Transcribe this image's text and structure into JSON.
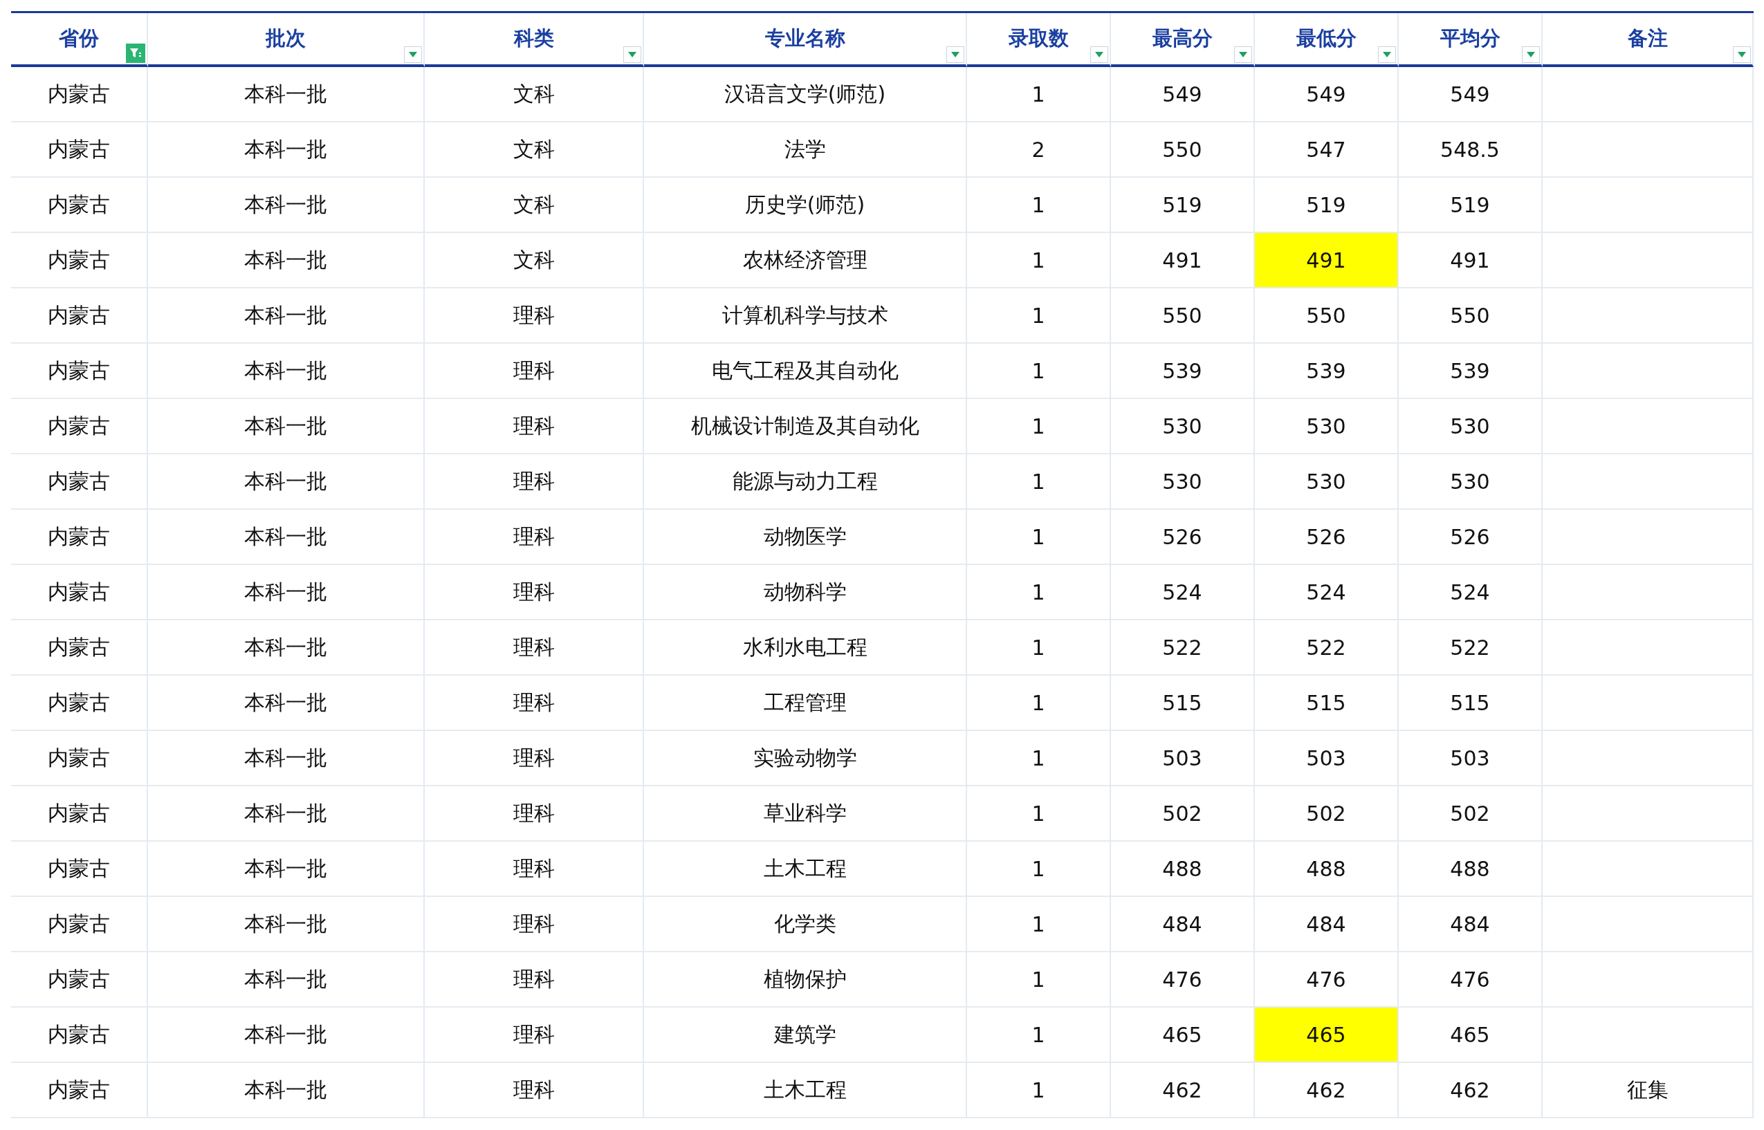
{
  "table": {
    "columns": [
      {
        "label": "省份",
        "filtered": true
      },
      {
        "label": "批次",
        "filtered": false
      },
      {
        "label": "科类",
        "filtered": false
      },
      {
        "label": "专业名称",
        "filtered": false
      },
      {
        "label": "录取数",
        "filtered": false
      },
      {
        "label": "最高分",
        "filtered": false
      },
      {
        "label": "最低分",
        "filtered": false
      },
      {
        "label": "平均分",
        "filtered": false
      },
      {
        "label": "备注",
        "filtered": false
      }
    ],
    "rows": [
      {
        "cells": [
          "内蒙古",
          "本科一批",
          "文科",
          "汉语言文学(师范)",
          "1",
          "549",
          "549",
          "549"
        ],
        "min_highlighted": false
      },
      {
        "cells": [
          "内蒙古",
          "本科一批",
          "文科",
          "法学",
          "2",
          "550",
          "547",
          "548.5"
        ],
        "min_highlighted": false
      },
      {
        "cells": [
          "内蒙古",
          "本科一批",
          "文科",
          "历史学(师范)",
          "1",
          "519",
          "519",
          "519"
        ],
        "min_highlighted": false
      },
      {
        "cells": [
          "内蒙古",
          "本科一批",
          "文科",
          "农林经济管理",
          "1",
          "491",
          "491",
          "491"
        ],
        "min_highlighted": true
      },
      {
        "cells": [
          "内蒙古",
          "本科一批",
          "理科",
          "计算机科学与技术",
          "1",
          "550",
          "550",
          "550"
        ],
        "min_highlighted": false
      },
      {
        "cells": [
          "内蒙古",
          "本科一批",
          "理科",
          "电气工程及其自动化",
          "1",
          "539",
          "539",
          "539"
        ],
        "min_highlighted": false
      },
      {
        "cells": [
          "内蒙古",
          "本科一批",
          "理科",
          "机械设计制造及其自动化",
          "1",
          "530",
          "530",
          "530"
        ],
        "min_highlighted": false
      },
      {
        "cells": [
          "内蒙古",
          "本科一批",
          "理科",
          "能源与动力工程",
          "1",
          "530",
          "530",
          "530"
        ],
        "min_highlighted": false
      },
      {
        "cells": [
          "内蒙古",
          "本科一批",
          "理科",
          "动物医学",
          "1",
          "526",
          "526",
          "526"
        ],
        "min_highlighted": false
      },
      {
        "cells": [
          "内蒙古",
          "本科一批",
          "理科",
          "动物科学",
          "1",
          "524",
          "524",
          "524"
        ],
        "min_highlighted": false
      },
      {
        "cells": [
          "内蒙古",
          "本科一批",
          "理科",
          "水利水电工程",
          "1",
          "522",
          "522",
          "522"
        ],
        "min_highlighted": false
      },
      {
        "cells": [
          "内蒙古",
          "本科一批",
          "理科",
          "工程管理",
          "1",
          "515",
          "515",
          "515"
        ],
        "min_highlighted": false
      },
      {
        "cells": [
          "内蒙古",
          "本科一批",
          "理科",
          "实验动物学",
          "1",
          "503",
          "503",
          "503"
        ],
        "min_highlighted": false
      },
      {
        "cells": [
          "内蒙古",
          "本科一批",
          "理科",
          "草业科学",
          "1",
          "502",
          "502",
          "502"
        ],
        "min_highlighted": false
      },
      {
        "cells": [
          "内蒙古",
          "本科一批",
          "理科",
          "土木工程",
          "1",
          "488",
          "488",
          "488"
        ],
        "min_highlighted": false
      },
      {
        "cells": [
          "内蒙古",
          "本科一批",
          "理科",
          "化学类",
          "1",
          "484",
          "484",
          "484"
        ],
        "min_highlighted": false
      },
      {
        "cells": [
          "内蒙古",
          "本科一批",
          "理科",
          "植物保护",
          "1",
          "476",
          "476",
          "476"
        ],
        "min_highlighted": false
      },
      {
        "cells": [
          "内蒙古",
          "本科一批",
          "理科",
          "建筑学",
          "1",
          "465",
          "465",
          "465"
        ],
        "min_highlighted": true
      },
      {
        "cells": [
          "内蒙古",
          "本科一批",
          "理科",
          "土木工程",
          "1",
          "462",
          "462",
          "462",
          "征集"
        ],
        "min_highlighted": false
      }
    ]
  }
}
